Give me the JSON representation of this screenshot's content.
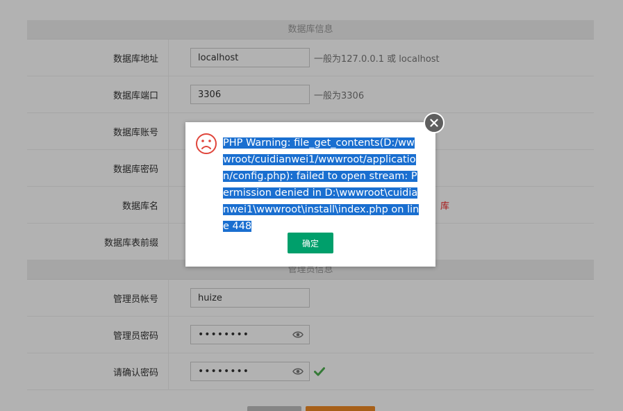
{
  "db_section": {
    "title": "数据库信息",
    "rows": [
      {
        "label": "数据库地址",
        "value": "localhost",
        "hint": "一般为127.0.0.1 或 localhost"
      },
      {
        "label": "数据库端口",
        "value": "3306",
        "hint": "一般为3306"
      },
      {
        "label": "数据库账号"
      },
      {
        "label": "数据库密码"
      },
      {
        "label": "数据库名",
        "hint_red": "库"
      },
      {
        "label": "数据库表前缀"
      }
    ]
  },
  "admin_section": {
    "title": "管理员信息",
    "rows": [
      {
        "label": "管理员帐号",
        "value": "huize"
      },
      {
        "label": "管理员密码",
        "value": "••••••••"
      },
      {
        "label": "请确认密码",
        "value": "••••••••"
      }
    ]
  },
  "dialog": {
    "message": "PHP Warning: file_get_contents(D:/wwwroot/cuidianwei1/wwwroot/application/config.php): failed to open stream: Permission denied in D:\\wwwroot\\cuidianwei1\\wwwroot\\install\\index.php on line 448",
    "ok_label": "确定"
  },
  "colors": {
    "ok_button": "#009f6b",
    "selection": "#1a6fd0",
    "sad_icon": "#e0453b",
    "check": "#4caf50"
  }
}
